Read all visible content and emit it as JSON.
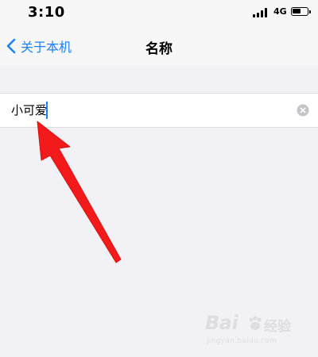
{
  "status_bar": {
    "time": "3:10",
    "network": "4G",
    "signal_bars_filled": 4,
    "battery_level": 0.6
  },
  "nav": {
    "back_label": "关于本机",
    "title": "名称"
  },
  "name_field": {
    "value": "小可爱"
  },
  "watermark": {
    "logo": "Bai",
    "logo_text": "经验",
    "url": "jingyan.baidu.com"
  },
  "colors": {
    "accent": "#1a82fb",
    "background": "#f1f1f6",
    "arrow": "#f21a1a"
  },
  "icons": {
    "back": "chevron-left-icon",
    "clear": "clear-x-circle-icon",
    "annotation": "red-arrow-icon"
  }
}
